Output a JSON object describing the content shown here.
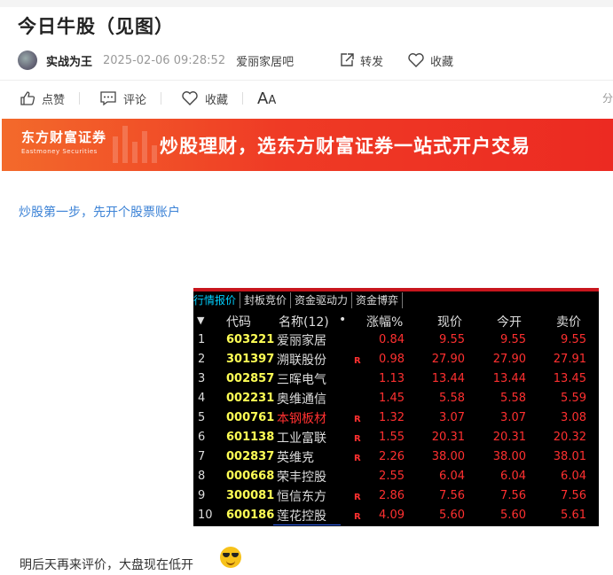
{
  "post": {
    "title": "今日牛股（见图）",
    "author": "实战为王",
    "time": "2025-02-06 09:28:52",
    "bar": "爱丽家居吧",
    "forward_label": "转发",
    "favorite_label": "收藏"
  },
  "actions": {
    "like_label": "点赞",
    "comment_label": "评论",
    "collect_label": "收藏",
    "font_large": "A",
    "font_small": "A",
    "edge_glyph": "分"
  },
  "banner": {
    "logo_cn": "东方财富证券",
    "logo_en": "Eastmoney Securities",
    "slogan": "炒股理财，选东方财富证券一站式开户交易"
  },
  "content": {
    "link_text": "炒股第一步，先开个股票账户",
    "footer_text": "明后天再来评价，大盘现在低开"
  },
  "quote_table": {
    "tabs": [
      "行情报价",
      "封板竞价",
      "资金驱动力",
      "资金博弈"
    ],
    "headers": {
      "arrow": "▼",
      "code": "代码",
      "name": "名称(12)",
      "dot": "•",
      "pct": "涨幅%",
      "price": "现价",
      "open": "今开",
      "ask": "卖价"
    },
    "rows": [
      {
        "idx": "1",
        "code": "603221",
        "name": "爱丽家居",
        "r": "",
        "pct": "0.84",
        "price": "9.55",
        "open": "9.55",
        "ask": "9.55"
      },
      {
        "idx": "2",
        "code": "301397",
        "name": "溯联股份",
        "r": "R",
        "pct": "0.98",
        "price": "27.90",
        "open": "27.90",
        "ask": "27.91"
      },
      {
        "idx": "3",
        "code": "002857",
        "name": "三晖电气",
        "r": "",
        "pct": "1.13",
        "price": "13.44",
        "open": "13.44",
        "ask": "13.45"
      },
      {
        "idx": "4",
        "code": "002231",
        "name": "奥维通信",
        "r": "",
        "pct": "1.45",
        "price": "5.58",
        "open": "5.58",
        "ask": "5.59"
      },
      {
        "idx": "5",
        "code": "000761",
        "name": "本钢板材",
        "r": "R",
        "pct": "1.32",
        "price": "3.07",
        "open": "3.07",
        "ask": "3.08"
      },
      {
        "idx": "6",
        "code": "601138",
        "name": "工业富联",
        "r": "R",
        "pct": "1.55",
        "price": "20.31",
        "open": "20.31",
        "ask": "20.32"
      },
      {
        "idx": "7",
        "code": "002837",
        "name": "英维克",
        "r": "R",
        "pct": "2.26",
        "price": "38.00",
        "open": "38.00",
        "ask": "38.01"
      },
      {
        "idx": "8",
        "code": "000668",
        "name": "荣丰控股",
        "r": "",
        "pct": "2.55",
        "price": "6.04",
        "open": "6.04",
        "ask": "6.04"
      },
      {
        "idx": "9",
        "code": "300081",
        "name": "恒信东方",
        "r": "R",
        "pct": "2.86",
        "price": "7.56",
        "open": "7.56",
        "ask": "7.56"
      },
      {
        "idx": "10",
        "code": "600186",
        "name": "莲花控股",
        "r": "R",
        "pct": "4.09",
        "price": "5.60",
        "open": "5.60",
        "ask": "5.61"
      }
    ]
  },
  "colors": {
    "accent_link": "#3b82d6",
    "quote_up": "#ff3030",
    "quote_code": "#ffff55",
    "banner_red": "#ec2a22"
  }
}
